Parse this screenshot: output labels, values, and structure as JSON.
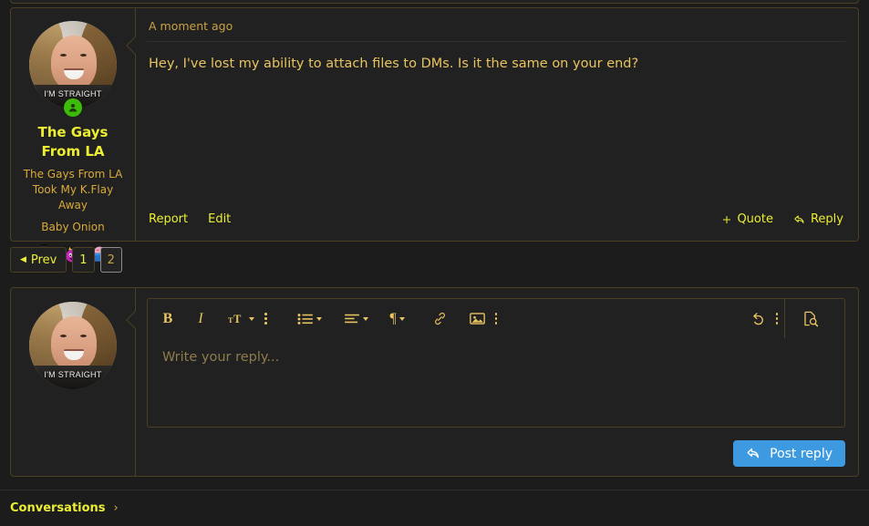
{
  "colors": {
    "page_bg": "#1c1c1c",
    "card_bg": "#212121",
    "border": "#4b4023",
    "accent_yellow": "#ecee33",
    "text_gold": "#e8c460",
    "muted_gold": "#c9a243",
    "button_blue": "#3d9ae0",
    "online_green": "#3dbb09"
  },
  "post": {
    "user": {
      "username": "The Gays From LA",
      "title": "The Gays From LA Took My K.Flay Away",
      "rank": "Baby Onion",
      "avatar_overlay_text": "I'M STRAIGHT",
      "online_status": "online",
      "badges": [
        {
          "name": "frog-tophat-badge",
          "label": "Frog in a top hat"
        },
        {
          "name": "purple-onion-badge",
          "label": "Crowned purple onion"
        },
        {
          "name": "brain-box-badge",
          "label": "Brain in a blue box"
        }
      ]
    },
    "timestamp": "A moment ago",
    "message": "Hey, I've lost my ability to attach files to DMs. Is it the same on your end?",
    "actions_left": [
      {
        "name": "report",
        "label": "Report"
      },
      {
        "name": "edit",
        "label": "Edit"
      }
    ],
    "actions_right": [
      {
        "name": "quote",
        "label": "Quote",
        "icon": "plus-icon"
      },
      {
        "name": "reply",
        "label": "Reply",
        "icon": "reply-arrow-icon"
      }
    ]
  },
  "pagination": {
    "prev_label": "Prev",
    "pages": [
      "1",
      "2"
    ],
    "current_page": "2"
  },
  "reply_editor": {
    "avatar_overlay_text": "I'M STRAIGHT",
    "placeholder": "Write your reply...",
    "toolbar": {
      "bold": "B",
      "italic": "I",
      "font_size": "TT",
      "more_text_options": "more-options-icon",
      "bullet_list": "bullet-list-icon",
      "align": "align-icon",
      "paragraph": "¶",
      "link": "link-icon",
      "image": "image-icon",
      "more_insert_options": "more-options-icon",
      "undo": "undo-icon",
      "more_actions": "more-options-icon",
      "preview": "document-preview-icon"
    },
    "submit_label": "Post reply",
    "submit_icon": "reply-arrow-icon"
  },
  "footer": {
    "conversations_label": "Conversations",
    "chevron": "›"
  }
}
